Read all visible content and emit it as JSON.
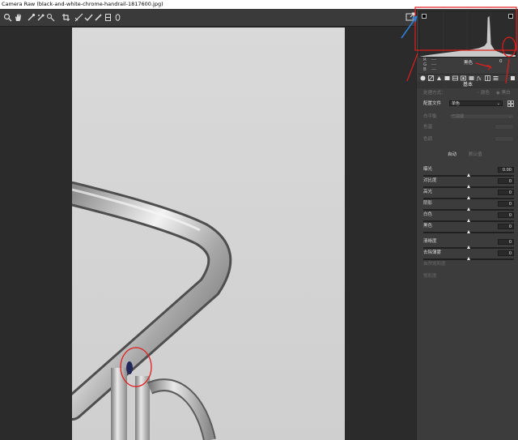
{
  "window": {
    "title": "Camera Raw (black-and-white-chrome-handrail-1817600.jpg)"
  },
  "toolbar": {
    "tools": [
      "zoom-tool",
      "hand-tool",
      "white-balance-tool",
      "color-sampler-tool",
      "targeted-adjustment-tool",
      "crop-tool",
      "straighten-tool",
      "spot-removal-tool",
      "red-eye-tool",
      "adjustment-brush-tool",
      "graduated-filter-tool",
      "radial-filter-tool"
    ]
  },
  "histogram": {
    "readout": {
      "r": "R",
      "g": "G",
      "b": "B",
      "dashes": "---",
      "label": "黑色",
      "value": "0"
    }
  },
  "panel": {
    "section_title": "基本",
    "treatment": {
      "label": "处理方式：",
      "option_color": "颜色",
      "option_bw": "黑白"
    },
    "profile": {
      "label": "配置文件",
      "value": "单色"
    },
    "white_balance": {
      "label": "白平衡",
      "value": "已拍摄"
    },
    "temperature_label": "色温",
    "tint_label": "色调",
    "auto_label": "自动",
    "default_label": "默认值",
    "sliders": [
      {
        "name": "曝光",
        "value": "0.00",
        "pos": 0.5,
        "dim": false
      },
      {
        "name": "对比度",
        "value": "0",
        "pos": 0.5,
        "dim": false
      },
      {
        "name": "高光",
        "value": "0",
        "pos": 0.5,
        "dim": false
      },
      {
        "name": "阴影",
        "value": "0",
        "pos": 0.5,
        "dim": false
      },
      {
        "name": "白色",
        "value": "0",
        "pos": 0.5,
        "dim": false
      },
      {
        "name": "黑色",
        "value": "0",
        "pos": 0.5,
        "dim": false
      },
      {
        "name": "清晰度",
        "value": "0",
        "pos": 0.5,
        "dim": false
      },
      {
        "name": "去除薄雾",
        "value": "0",
        "pos": 0.5,
        "dim": false
      },
      {
        "name": "自然饱和度",
        "value": "",
        "pos": 0.5,
        "dim": true
      },
      {
        "name": "饱和度",
        "value": "",
        "pos": 0.5,
        "dim": true
      }
    ]
  },
  "colors": {
    "annotation_red": "#e11d1d",
    "annotation_blue": "#2f7fd8"
  }
}
